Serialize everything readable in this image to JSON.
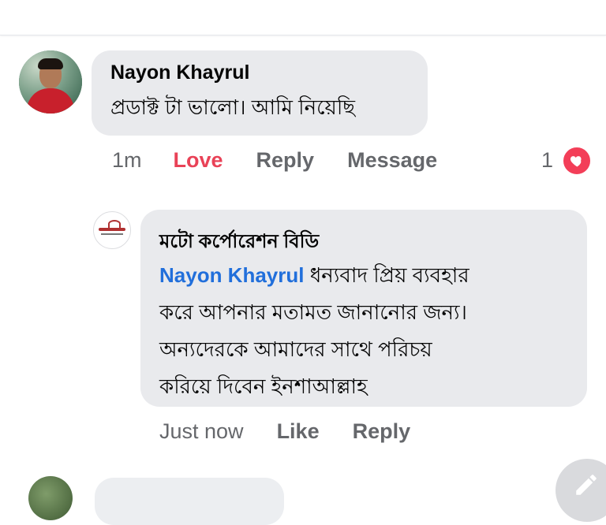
{
  "comment": {
    "author": "Nayon Khayrul",
    "text": "প্রডাক্ট টা ভালো। আমি নিয়েছি",
    "actions": {
      "time": "1m",
      "love": "Love",
      "reply": "Reply",
      "message": "Message"
    },
    "reaction_count": "1",
    "reaction_icon": "heart-icon"
  },
  "reply": {
    "author": "মটো কর্পোরেশন বিডি",
    "mention": "Nayon Khayrul",
    "lines": [
      " ধন্যবাদ প্রিয় ব্যবহার",
      "করে আপনার মতামত জানানোর জন্য।",
      "অন্যদেরকে আমাদের সাথে পরিচয়",
      "করিয়ে দিবেন ইনশাআল্লাহ"
    ],
    "actions": {
      "time": "Just now",
      "like": "Like",
      "reply": "Reply"
    }
  },
  "colors": {
    "love": "#e94257",
    "mention": "#216fdb",
    "bubble": "#e9eaed",
    "muted": "#65676b"
  },
  "fab_icon": "pencil-icon"
}
